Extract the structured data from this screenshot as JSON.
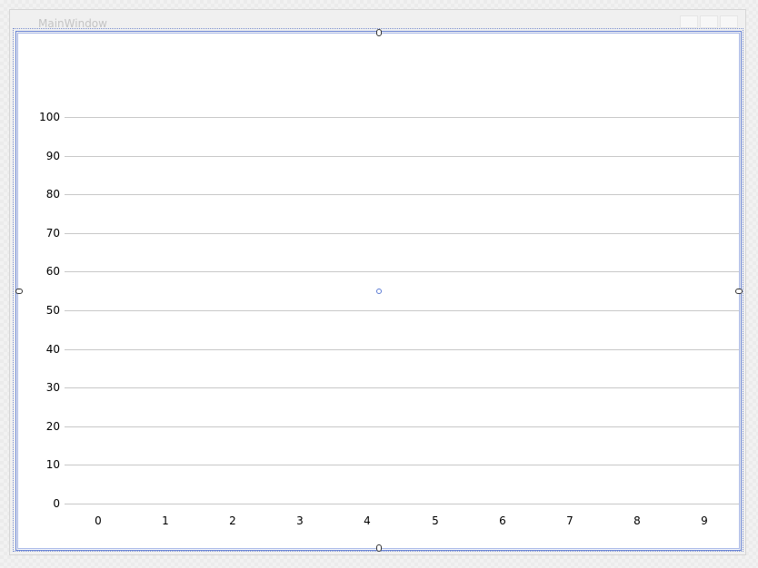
{
  "window": {
    "title": "MainWindow"
  },
  "chart_data": {
    "type": "line",
    "title": "",
    "xlabel": "",
    "ylabel": "",
    "x_ticks": [
      "0",
      "1",
      "2",
      "3",
      "4",
      "5",
      "6",
      "7",
      "8",
      "9"
    ],
    "y_ticks": [
      "100",
      "90",
      "80",
      "70",
      "60",
      "50",
      "40",
      "30",
      "20",
      "10",
      "0"
    ],
    "xlim": [
      0,
      9
    ],
    "ylim": [
      0,
      100
    ],
    "grid": true,
    "series": []
  }
}
